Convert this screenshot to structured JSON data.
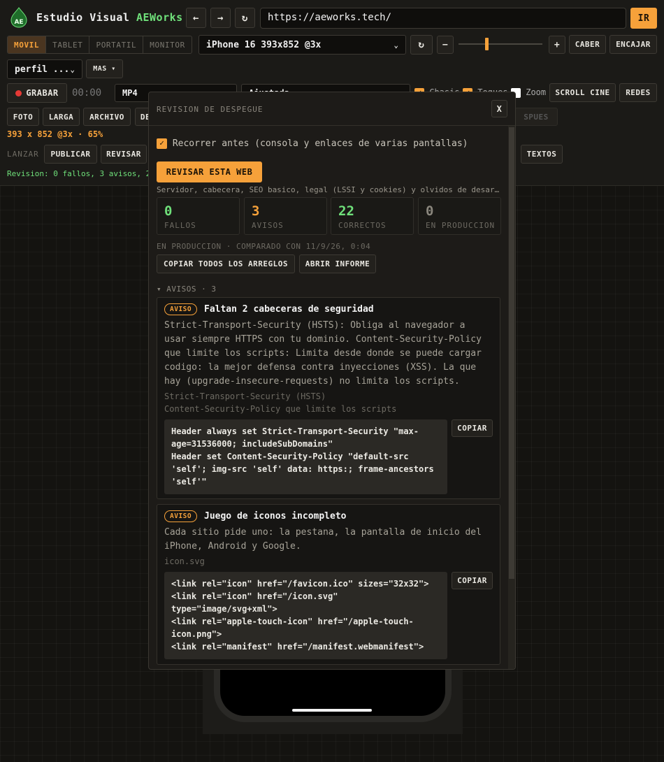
{
  "app": {
    "title_prefix": "Estudio Visual",
    "title_brand": "AEWorks",
    "logo_text": "AE"
  },
  "nav": {
    "back": "←",
    "forward": "→",
    "reload": "↻",
    "url": "https://aeworks.tech/",
    "go": "IR"
  },
  "device_tabs": [
    "MOVIL",
    "TABLET",
    "PORTATIL",
    "MONITOR"
  ],
  "device_select": "iPhone 16 393x852 @3x",
  "rotate": "↻",
  "zoom_minus": "−",
  "zoom_plus": "+",
  "zoom_level": 0.3,
  "fit_button": "CABER",
  "frame_button": "ENCAJAR",
  "profile_select": "perfil ...",
  "more_button": "MAS",
  "record": {
    "label": "GRABAR",
    "time": "00:00",
    "format": "MP4",
    "quality": "Ajustada"
  },
  "toggles": [
    {
      "label": "Chasis",
      "checked": true
    },
    {
      "label": "Toques",
      "checked": true
    },
    {
      "label": "Zoom",
      "checked": false
    }
  ],
  "scroll_cine": "SCROLL CINE",
  "redes": "REDES",
  "row4": [
    "FOTO",
    "LARGA",
    "ARCHIVO",
    "DE"
  ],
  "ghost_button": "SPUES",
  "size_info": "393 x 852 @3x · 65%",
  "launch": {
    "label": "LANZAR",
    "publish": "PUBLICAR",
    "review": "REVISAR",
    "texts": "TEXTOS"
  },
  "status_line": "Revision: 0 fallos, 3 avisos, 2",
  "modal": {
    "title": "REVISION DE DESPEGUE",
    "close": "X",
    "check_label": "Recorrer antes (consola y enlaces de varias pantallas)",
    "check_on": true,
    "run_button": "REVISAR ESTA WEB",
    "subtitle": "Servidor, cabecera, SEO basico, legal (LSSI y cookies) y olvidos de desar…",
    "stats": [
      {
        "value": "0",
        "label": "FALLOS",
        "color": "#6fe07a"
      },
      {
        "value": "3",
        "label": "AVISOS",
        "color": "#f6a13a"
      },
      {
        "value": "22",
        "label": "CORRECTOS",
        "color": "#6fe07a"
      },
      {
        "value": "0",
        "label": "EN PRODUCCION",
        "color": "#8a867d"
      }
    ],
    "compare_line": "EN PRODUCCION · COMPARADO CON 11/9/26, 0:04",
    "copy_all": "COPIAR TODOS LOS ARREGLOS",
    "open_report": "ABRIR INFORME",
    "section": "▾ AVISOS · 3",
    "cards": [
      {
        "badge": "AVISO",
        "title": "Faltan 2 cabeceras de seguridad",
        "body": [
          "Strict-Transport-Security (HSTS): Obliga al navegador a",
          "usar siempre HTTPS con tu dominio. Content-Security-Policy",
          "que limite los scripts: Limita desde donde se puede cargar",
          "codigo: la mejor defensa contra inyecciones (XSS). La que",
          "hay (upgrade-insecure-requests) no limita los scripts."
        ],
        "sub": [
          "Strict-Transport-Security (HSTS)",
          "Content-Security-Policy que limite los scripts"
        ],
        "code": [
          "Header always set Strict-Transport-Security \"max-",
          "age=31536000; includeSubDomains\"",
          "Header set Content-Security-Policy \"default-src",
          "'self'; img-src 'self' data: https:; frame-ancestors",
          "'self'\""
        ],
        "copy": "COPIAR"
      },
      {
        "badge": "AVISO",
        "title": "Juego de iconos incompleto",
        "body": [
          "Cada sitio pide uno: la pestana, la pantalla de inicio del",
          "iPhone, Android y Google."
        ],
        "sub": [
          "icon.svg"
        ],
        "code": [
          "<link rel=\"icon\" href=\"/favicon.ico\" sizes=\"32x32\">",
          "<link rel=\"icon\" href=\"/icon.svg\"",
          "type=\"image/svg+xml\">",
          "<link rel=\"apple-touch-icon\" href=\"/apple-touch-",
          "icon.png\">",
          "<link rel=\"manifest\" href=\"/manifest.webmanifest\">"
        ],
        "copy": "COPIAR"
      }
    ]
  }
}
